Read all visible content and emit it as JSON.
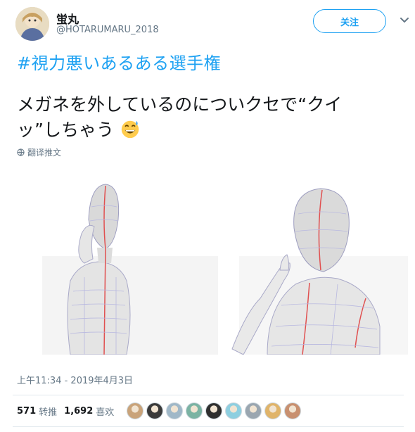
{
  "header": {
    "display_name": "蛍丸",
    "handle": "@HOTARUMARU_2018",
    "follow_label": "关注"
  },
  "tweet": {
    "hashtag": "#視力悪いあるある選手権",
    "text": "メガネを外しているのについクセで“クイッ”しちゃう",
    "emoji": "grinning-sweat-emoji",
    "translate_label": "翻译推文",
    "timestamp": "上午11:34 - 2019年4月3日"
  },
  "stats": {
    "retweets": "571",
    "retweets_label": "转推",
    "likes": "1,692",
    "likes_label": "喜欢"
  },
  "likers": [
    {
      "color": "#c9a37a"
    },
    {
      "color": "#3a3a3a"
    },
    {
      "color": "#a0b8c8"
    },
    {
      "color": "#7bb3a3"
    },
    {
      "color": "#2f2f2f"
    },
    {
      "color": "#8ecfe0"
    },
    {
      "color": "#9aa6b0"
    },
    {
      "color": "#e0b46a"
    },
    {
      "color": "#c89070"
    }
  ],
  "colors": {
    "accent": "#1da1f2",
    "text": "#14171a",
    "muted": "#657786"
  }
}
